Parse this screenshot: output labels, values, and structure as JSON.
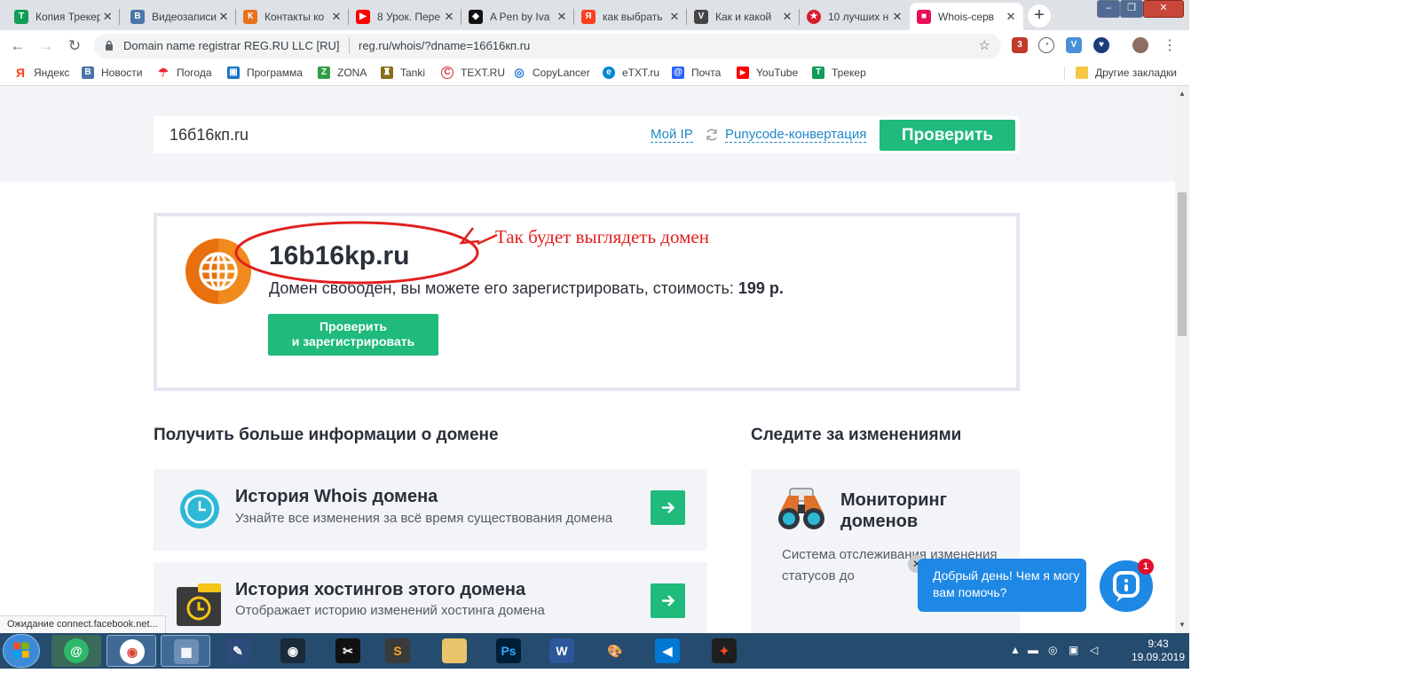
{
  "tabs": [
    {
      "title": "Копия Трекер",
      "color": "#0f9d58",
      "glyph": "Т"
    },
    {
      "title": "Видеозаписи",
      "color": "#4a76a8",
      "glyph": "В"
    },
    {
      "title": "Контакты ко",
      "color": "#e8711a",
      "glyph": "К"
    },
    {
      "title": "8 Урок. Пере",
      "color": "#ff0000",
      "glyph": "▶"
    },
    {
      "title": "A Pen by Iva",
      "color": "#111111",
      "glyph": "◆"
    },
    {
      "title": "как выбрать",
      "color": "#fc3f1d",
      "glyph": "Я"
    },
    {
      "title": "Как и какой",
      "color": "#444444",
      "glyph": "V"
    },
    {
      "title": "10 лучших н",
      "color": "#d81b2c",
      "glyph": "★"
    },
    {
      "title": "Whois-серв",
      "color": "#e8105a",
      "glyph": "■"
    }
  ],
  "browser": {
    "site_label": "Domain name registrar REG.RU LLC [RU]",
    "url": "reg.ru/whois/?dname=16б16кп.ru",
    "extension_badge": "3"
  },
  "bookmarks": [
    {
      "label": "Яндекс",
      "color": "#fc3f1d",
      "glyph": "Я"
    },
    {
      "label": "Новости",
      "color": "#4a76a8",
      "glyph": "В"
    },
    {
      "label": "Погода",
      "color": "#e8262d",
      "glyph": "☂"
    },
    {
      "label": "Программа",
      "color": "#1a73c8",
      "glyph": "▣"
    },
    {
      "label": "ZONA",
      "color": "#2f9e44",
      "glyph": "Z"
    },
    {
      "label": "Tanki",
      "color": "#8a6d1a",
      "glyph": "♜"
    },
    {
      "label": "TEXT.RU",
      "color": "#d32f2f",
      "glyph": "C"
    },
    {
      "label": "CopyLancer",
      "color": "#1976d2",
      "glyph": "◎"
    },
    {
      "label": "eTXT.ru",
      "color": "#0288d1",
      "glyph": "e"
    },
    {
      "label": "Почта",
      "color": "#2962ff",
      "glyph": "@"
    },
    {
      "label": "YouTube",
      "color": "#ff0000",
      "glyph": "▶"
    },
    {
      "label": "Трекер",
      "color": "#0f9d58",
      "glyph": "Т"
    }
  ],
  "other_bookmarks": "Другие закладки",
  "search": {
    "value": "16б16кп.ru",
    "my_ip": "Мой IP",
    "punycode": "Punycode-конвертация",
    "check_button": "Проверить"
  },
  "result": {
    "domain": "16b16kp.ru",
    "status": "Домен свободен, вы можете его зарегистрировать, стоимость:",
    "price": "199 р.",
    "register_line1": "Проверить",
    "register_line2": "и зарегистрировать"
  },
  "annotation": {
    "text": "Так будет выглядеть домен",
    "color": "#e0201f"
  },
  "info": {
    "heading": "Получить больше информации о домене",
    "cards": [
      {
        "title": "История Whois домена",
        "desc": "Узнайте все изменения за всё время существования домена"
      },
      {
        "title": "История хостингов этого домена",
        "desc": "Отображает историю изменений хостинга домена"
      }
    ]
  },
  "watch": {
    "heading": "Следите за изменениями",
    "title": "Мониторинг доменов",
    "desc": "Система отслеживания изменения статусов до"
  },
  "chat": {
    "message": "Добрый день! Чем я могу вам помочь?",
    "badge": "1",
    "close": "✕"
  },
  "status_bar": "Ожидание connect.facebook.net...",
  "clock": {
    "time": "9:43",
    "date": "19.09.2019"
  },
  "colors": {
    "accent_green": "#1fba7c",
    "link_blue": "#1e88c8",
    "chat_blue": "#1e88e5",
    "taskbar": "#254b6e"
  }
}
